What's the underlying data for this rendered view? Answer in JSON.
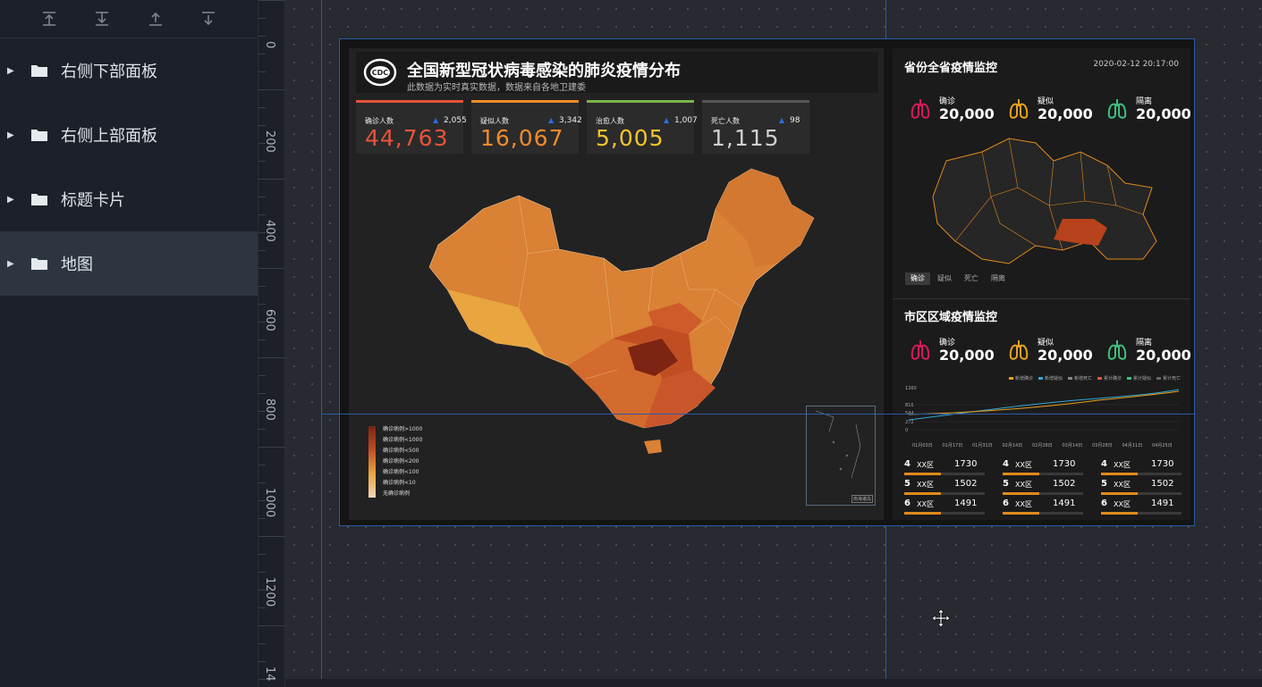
{
  "toolbar": {
    "buttons": [
      {
        "icon": "move-top-icon"
      },
      {
        "icon": "move-bottom-icon"
      },
      {
        "icon": "move-up-icon"
      },
      {
        "icon": "move-down-icon"
      }
    ]
  },
  "layers": [
    {
      "label": "右侧下部面板",
      "active": false
    },
    {
      "label": "右侧上部面板",
      "active": false
    },
    {
      "label": "标题卡片",
      "active": false
    },
    {
      "label": "地图",
      "active": true
    }
  ],
  "ruler": {
    "labels": [
      "0",
      "200",
      "400",
      "600",
      "800",
      "1000",
      "1200",
      "14"
    ]
  },
  "dashboard": {
    "title": "全国新型冠状病毒感染的肺炎疫情分布",
    "subtitle": "此数据为实时真实数据，数据来自各地卫建委",
    "logo_text": "CDC",
    "stats": [
      {
        "label": "确诊人数",
        "increase": "2,055",
        "value": "44,763",
        "color": "#e5533a",
        "top_color": "#e5533a"
      },
      {
        "label": "疑似人数",
        "increase": "3,342",
        "value": "16,067",
        "color": "#f08b2c",
        "top_color": "#f08b2c"
      },
      {
        "label": "治愈人数",
        "increase": "1,007",
        "value": "5,005",
        "color": "#f5c42b",
        "top_color": "#7ab648"
      },
      {
        "label": "死亡人数",
        "increase": "98",
        "value": "1,115",
        "color": "#d0d0d0",
        "top_color": "#555555"
      }
    ],
    "legend": [
      "确诊病例>1000",
      "确诊病例<1000",
      "确诊病例<500",
      "确诊病例<200",
      "确诊病例<100",
      "确诊病例<10",
      "无确诊病例"
    ],
    "inset_label": "南海诸岛",
    "province_panel": {
      "title": "省份全省疫情监控",
      "date": "2020-02-12 20:17:00",
      "indicators": [
        {
          "label": "确诊",
          "value": "20,000",
          "color": "#d6195f"
        },
        {
          "label": "疑似",
          "value": "20,000",
          "color": "#e8a21d"
        },
        {
          "label": "隔离",
          "value": "20,000",
          "color": "#3fc07e"
        }
      ],
      "tabs": [
        "确诊",
        "疑似",
        "死亡",
        "隔离"
      ]
    },
    "city_panel": {
      "title": "市区区域疫情监控",
      "indicators": [
        {
          "label": "确诊",
          "value": "20,000",
          "color": "#d6195f"
        },
        {
          "label": "疑似",
          "value": "20,000",
          "color": "#e8a21d"
        },
        {
          "label": "隔离",
          "value": "20,000",
          "color": "#3fc07e"
        }
      ],
      "line_legend": [
        {
          "name": "新增确诊",
          "color": "#e8a21d"
        },
        {
          "name": "新增疑似",
          "color": "#35a7d6"
        },
        {
          "name": "新增死亡",
          "color": "#888888"
        },
        {
          "name": "累计确诊",
          "color": "#e5533a"
        },
        {
          "name": "累计疑似",
          "color": "#3fc07e"
        },
        {
          "name": "累计死亡",
          "color": "#666666"
        }
      ],
      "y_labels": [
        "1360",
        "816",
        "544",
        "272",
        "0"
      ],
      "x_labels": [
        "01月03日",
        "01月17日",
        "01月31日",
        "02月14日",
        "02月28日",
        "03月14日",
        "03月28日",
        "04月11日",
        "04月25日"
      ],
      "ranking": [
        {
          "rank": "4",
          "name": "XX区",
          "value": "1730"
        },
        {
          "rank": "4",
          "name": "XX区",
          "value": "1730"
        },
        {
          "rank": "4",
          "name": "XX区",
          "value": "1730"
        },
        {
          "rank": "5",
          "name": "XX区",
          "value": "1502"
        },
        {
          "rank": "5",
          "name": "XX区",
          "value": "1502"
        },
        {
          "rank": "5",
          "name": "XX区",
          "value": "1502"
        },
        {
          "rank": "6",
          "name": "XX区",
          "value": "1491"
        },
        {
          "rank": "6",
          "name": "XX区",
          "value": "1491"
        },
        {
          "rank": "6",
          "name": "XX区",
          "value": "1491"
        }
      ]
    }
  }
}
